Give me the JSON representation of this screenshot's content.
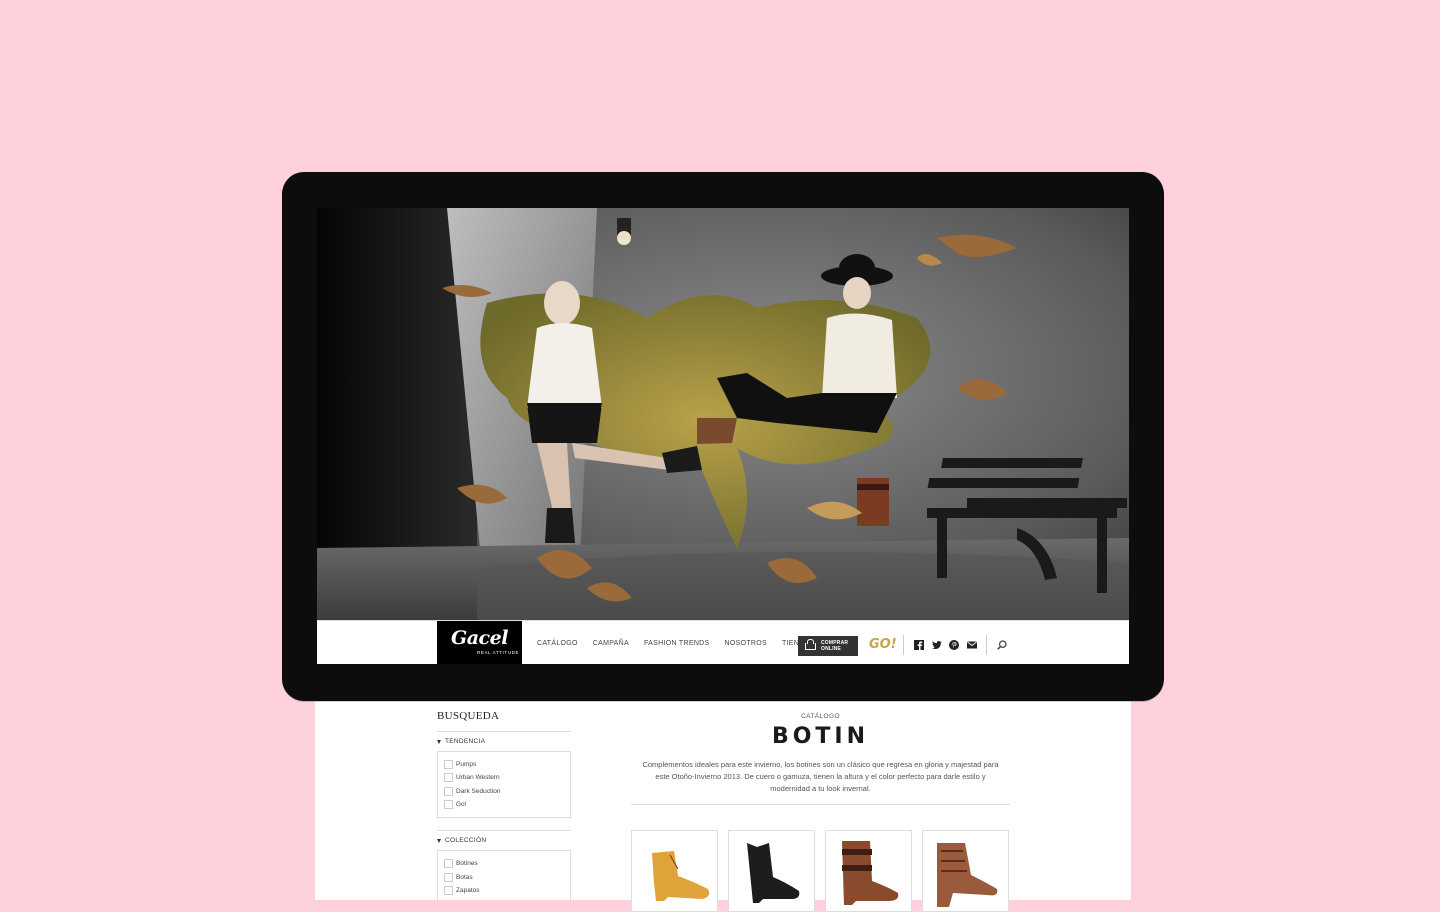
{
  "brand": {
    "logo_text": "Gacel",
    "logo_subtext": "REAL ATTITUDE",
    "partner_logo": "GO!"
  },
  "nav": {
    "items": [
      {
        "label": "CATÁLOGO"
      },
      {
        "label": "CAMPAÑA"
      },
      {
        "label": "FASHION TRENDS"
      },
      {
        "label": "NOSOTROS"
      },
      {
        "label": "TIENDAS"
      }
    ],
    "buy_button": {
      "line1": "COMPRAR",
      "line2": "ONLINE",
      "icon": "basket-icon"
    },
    "social_icons": [
      "facebook-icon",
      "twitter-icon",
      "pinterest-icon",
      "mail-icon"
    ],
    "search_icon": "search-icon"
  },
  "sidebar": {
    "title": "BUSQUEDA",
    "filters": [
      {
        "heading": "TENDENCIA",
        "options": [
          "Pumps",
          "Urban Western",
          "Dark Seduction",
          "Go!"
        ]
      },
      {
        "heading": "COLECCIÓN",
        "options": [
          "Botines",
          "Botas",
          "Zapatos"
        ]
      }
    ]
  },
  "main": {
    "section_label": "CATÁLOGO",
    "title": "BOTIN",
    "description": "Complementos ideales para este invierno, los botines son un clásico que regresa en gloria y majestad para este Otoño-Invierno 2013. De cuero o gamuza, tienen la altura y el color perfecto para darle estilo y modernidad a tu look invernal."
  },
  "products": [
    {
      "color": "#e0a33a"
    },
    {
      "color": "#1d1d1d"
    },
    {
      "color": "#8a4a2e"
    },
    {
      "color": "#9a5a3c"
    }
  ],
  "colors": {
    "background": "#ffd1dc",
    "device": "#0d0d0d",
    "accent_gold": "#c9a54a",
    "buy_button": "#333333"
  }
}
